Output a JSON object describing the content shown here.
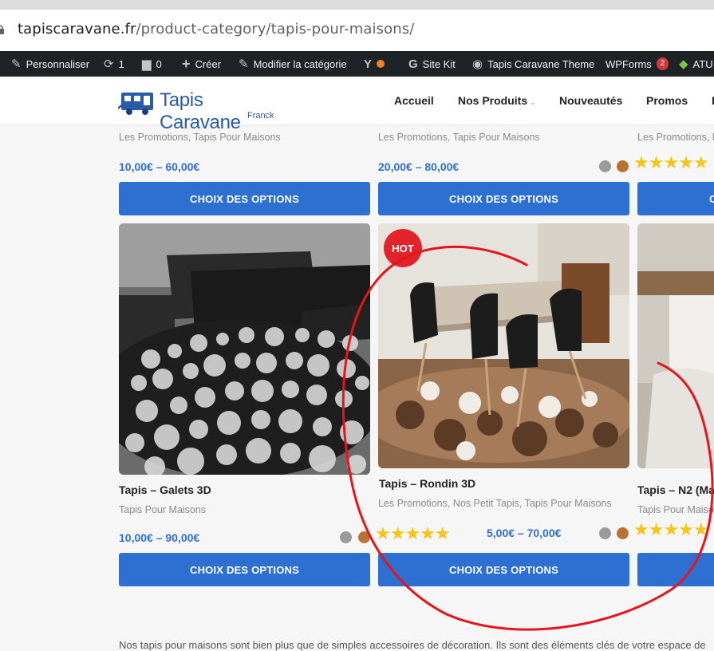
{
  "browser": {
    "url_host": "tapiscaravane.fr",
    "url_path": "/product-category/tapis-pour-maisons/"
  },
  "adminbar": {
    "customize": "Personnaliser",
    "updates_count": "1",
    "comments_count": "0",
    "new": "Créer",
    "edit_category": "Modifier la catégorie",
    "site_kit": "Site Kit",
    "theme": "Tapis Caravane Theme",
    "wpforms": "WPForms",
    "wpforms_badge": "2",
    "atu": "ATU"
  },
  "header": {
    "logo_text": "Tapis Caravane",
    "logo_sub": "Franck",
    "nav": [
      "Accueil",
      "Nos Produits",
      "Nouveautés",
      "Promos",
      "I"
    ]
  },
  "row1": [
    {
      "categories": "Les Promotions, Tapis Pour Maisons",
      "price": "10,00€ – 60,00€",
      "button": "CHOIX DES OPTIONS"
    },
    {
      "categories": "Les Promotions, Tapis Pour Maisons",
      "price": "20,00€ – 80,00€",
      "button": "CHOIX DES OPTIONS",
      "rating": "★★★★★"
    },
    {
      "categories": "Les Promotions, N",
      "button": "C"
    }
  ],
  "row2": [
    {
      "title": "Tapis – Galets 3D",
      "categories": "Tapis Pour Maisons",
      "price": "10,00€ – 90,00€",
      "button": "CHOIX DES OPTIONS",
      "rating": "★★★★★"
    },
    {
      "badge": "HOT",
      "title": "Tapis – Rondin 3D",
      "categories": "Les Promotions, Nos Petit Tapis, Tapis Pour Maisons",
      "price": "5,00€ – 70,00€",
      "button": "CHOIX DES OPTIONS",
      "rating": "★★★★★"
    },
    {
      "title": "Tapis – N2 (Ma",
      "categories": "Tapis Pour Maiso"
    }
  ],
  "description": "Nos tapis pour maisons sont bien plus que de simples accessoires de décoration. Ils sont des éléments clés de votre espace de",
  "colors": {
    "accent": "#2e6fd2",
    "hot": "#e3232a",
    "star": "#f5c518",
    "swatch_grey": "#9a9a9a",
    "swatch_brown": "#b87333",
    "annotation": "#e8141b"
  }
}
